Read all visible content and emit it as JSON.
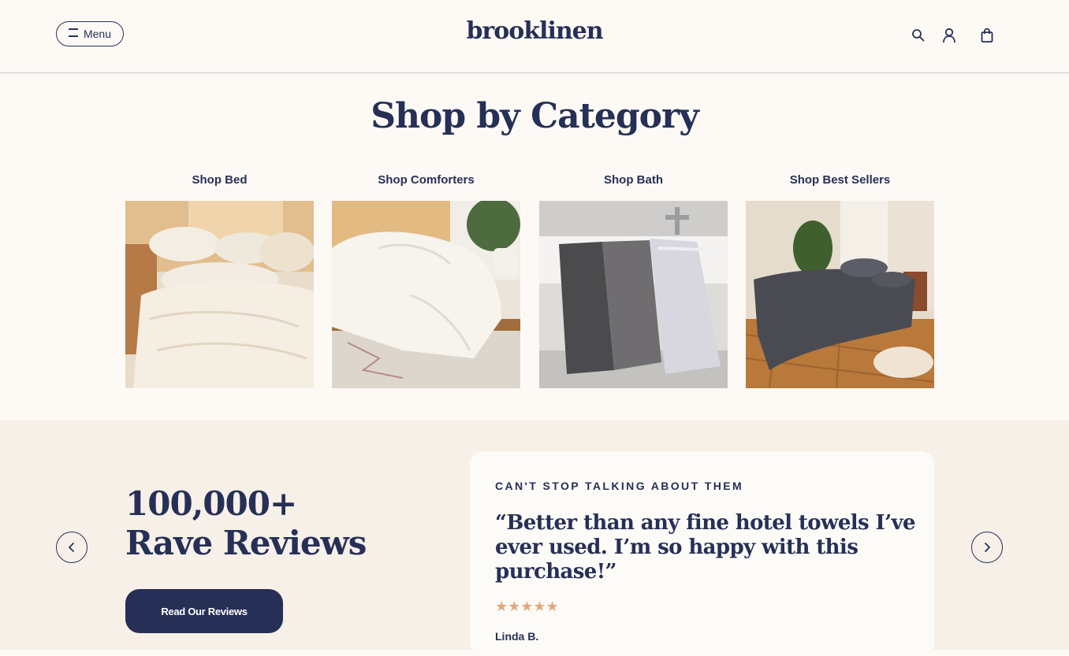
{
  "header": {
    "menu_label": "Menu",
    "logo_text": "brooklinen",
    "icons": [
      "search-icon",
      "account-icon",
      "cart-icon"
    ]
  },
  "category_section": {
    "title": "Shop by Category",
    "items": [
      {
        "label": "Shop Bed",
        "image": "cream-bedding-photo"
      },
      {
        "label": "Shop Comforters",
        "image": "white-comforter-photo"
      },
      {
        "label": "Shop Bath",
        "image": "towels-bathtub-photo"
      },
      {
        "label": "Shop Best Sellers",
        "image": "grey-bedding-room-photo"
      }
    ]
  },
  "reviews_section": {
    "headline": "100,000+ Rave Reviews",
    "cta_label": "Read Our Reviews",
    "eyebrow": "CAN'T STOP TALKING ABOUT THEM",
    "quote": "“Better than any fine hotel towels I’ve ever used. I’m so happy with this purchase!”",
    "stars": "★★★★★",
    "rating": 5,
    "author": "Linda B."
  },
  "colors": {
    "navy": "#263056",
    "page_bg": "#fdfaf6",
    "reviews_bg": "#f6f0e9",
    "star": "#e2a77c"
  }
}
